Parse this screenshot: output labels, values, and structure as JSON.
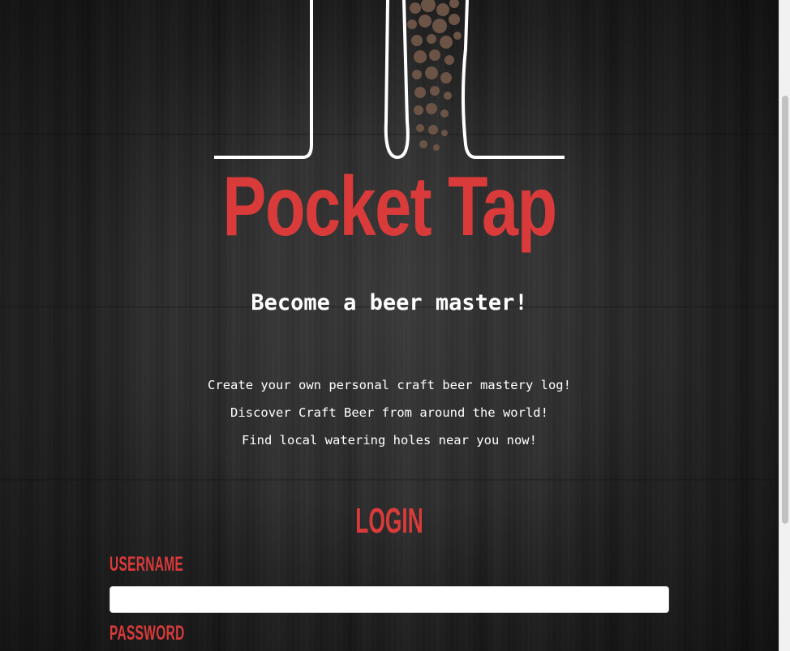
{
  "brand": {
    "name": "Pocket Tap",
    "accent_color": "#d93a3a",
    "logo_icon": "beer-glass-icon"
  },
  "hero": {
    "tagline": "Become a beer master!",
    "features": [
      "Create your own personal craft beer mastery log!",
      "Discover Craft Beer from around the world!",
      "Find local watering holes near you now!"
    ]
  },
  "login": {
    "heading": "LOGIN",
    "username_label": "USERNAME",
    "username_value": "",
    "password_label": "PASSWORD"
  }
}
